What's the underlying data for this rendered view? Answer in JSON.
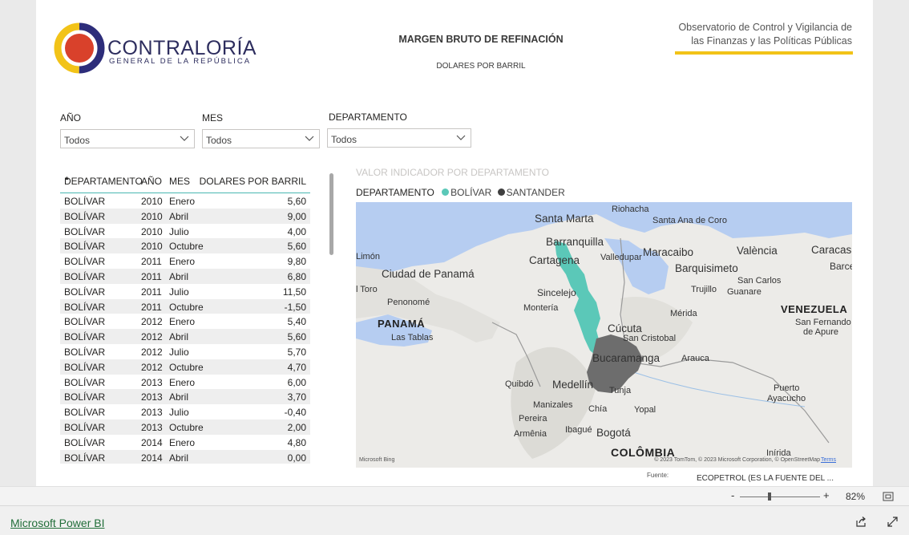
{
  "header": {
    "logo_main": "CONTRALORÍA",
    "logo_sub": "GENERAL DE LA REPÚBLICA",
    "title": "MARGEN BRUTO DE REFINACIÓN",
    "subtitle": "DOLARES POR BARRIL",
    "observatorio_line1": "Observatorio de Control y Vigilancia de",
    "observatorio_line2": "las Finanzas y las Políticas Públicas"
  },
  "filters": {
    "year": {
      "label": "AÑO",
      "value": "Todos"
    },
    "month": {
      "label": "MES",
      "value": "Todos"
    },
    "department": {
      "label": "DEPARTAMENTO",
      "value": "Todos"
    }
  },
  "table": {
    "columns": [
      "DEPARTAMENTO",
      "AÑO",
      "MES",
      "DOLARES POR BARRIL"
    ],
    "sort_indicator": "▲",
    "rows": [
      [
        "BOLÍVAR",
        "2010",
        "Enero",
        "5,60"
      ],
      [
        "BOLÍVAR",
        "2010",
        "Abril",
        "9,00"
      ],
      [
        "BOLÍVAR",
        "2010",
        "Julio",
        "4,00"
      ],
      [
        "BOLÍVAR",
        "2010",
        "Octubre",
        "5,60"
      ],
      [
        "BOLÍVAR",
        "2011",
        "Enero",
        "9,80"
      ],
      [
        "BOLÍVAR",
        "2011",
        "Abril",
        "6,80"
      ],
      [
        "BOLÍVAR",
        "2011",
        "Julio",
        "11,50"
      ],
      [
        "BOLÍVAR",
        "2011",
        "Octubre",
        "-1,50"
      ],
      [
        "BOLÍVAR",
        "2012",
        "Enero",
        "5,40"
      ],
      [
        "BOLÍVAR",
        "2012",
        "Abril",
        "5,60"
      ],
      [
        "BOLÍVAR",
        "2012",
        "Julio",
        "5,70"
      ],
      [
        "BOLÍVAR",
        "2012",
        "Octubre",
        "4,70"
      ],
      [
        "BOLÍVAR",
        "2013",
        "Enero",
        "6,00"
      ],
      [
        "BOLÍVAR",
        "2013",
        "Abril",
        "3,70"
      ],
      [
        "BOLÍVAR",
        "2013",
        "Julio",
        "-0,40"
      ],
      [
        "BOLÍVAR",
        "2013",
        "Octubre",
        "2,00"
      ],
      [
        "BOLÍVAR",
        "2014",
        "Enero",
        "4,80"
      ],
      [
        "BOLÍVAR",
        "2014",
        "Abril",
        "0,00"
      ]
    ]
  },
  "map": {
    "title": "VALOR INDICADOR POR DEPARTAMENTO",
    "legend_label": "DEPARTAMENTO",
    "legend": [
      {
        "name": "BOLÍVAR",
        "color": "#5bc8b8"
      },
      {
        "name": "SANTANDER",
        "color": "#3f3f3f"
      }
    ],
    "places": {
      "riohacha": "Riohacha",
      "santa_marta": "Santa Marta",
      "santa_ana_de_coro": "Santa Ana de Coro",
      "barranquilla": "Barranquilla",
      "cartagena": "Cartagena",
      "valledupar": "Valledupar",
      "maracaibo": "Maracaibo",
      "valencia": "València",
      "caracas": "Caracas",
      "barce": "Barce",
      "limon": "Limón",
      "ciudad_de_panama": "Ciudad de Panamá",
      "sincelejo": "Sincelejo",
      "barquisimeto": "Barquisimeto",
      "san_carlos": "San Carlos",
      "el_toro": "l Toro",
      "penonome": "Penonomé",
      "trujillo": "Trujillo",
      "guanare": "Guanare",
      "monteria": "Montería",
      "merida": "Mérida",
      "venezuela": "VENEZUELA",
      "panama": "PANAMÁ",
      "cucuta": "Cúcuta",
      "san_fernando": "San Fernando",
      "de_apure": "de Apure",
      "las_tablas": "Las Tablas",
      "san_cristobal": "San Cristobal",
      "bucaramanga": "Bucaramanga",
      "arauca": "Arauca",
      "quibdo": "Quibdó",
      "medellin": "Medellín",
      "tunja": "Tunja",
      "puerto": "Puerto",
      "ayacucho": "Ayacucho",
      "manizales": "Manizales",
      "yopal": "Yopal",
      "pereira": "Pereira",
      "chia": "Chía",
      "ibague": "Ibagué",
      "bogota": "Bogotá",
      "armenia": "Armênia",
      "colombia": "COLÔMBIA",
      "inirida": "Inírida"
    },
    "bing_credit": "Microsoft Bing",
    "copyright": "© 2023 TomTom, © 2023 Microsoft Corporation, © OpenStreetMap",
    "terms": "Terms"
  },
  "fuente": {
    "label": "Fuente:",
    "value": "ECOPETROL (ES LA FUENTE DEL ..."
  },
  "zoom": {
    "minus": "-",
    "plus": "+",
    "value": "82%",
    "level": 0.37
  },
  "footer": {
    "link": "Microsoft Power BI"
  }
}
